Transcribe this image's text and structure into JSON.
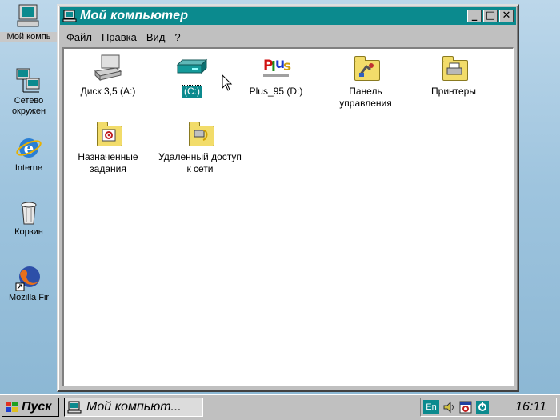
{
  "desktop": {
    "icons": [
      {
        "label": "Мой компь",
        "icon": "my-computer-icon"
      },
      {
        "label": "Сетевое окружение",
        "label_line1": "Сетево",
        "label_line2": "окружен",
        "icon": "network-icon"
      },
      {
        "label": "Interne",
        "icon": "internet-explorer-icon"
      },
      {
        "label": "Корзин",
        "icon": "recycle-bin-icon"
      },
      {
        "label": "Mozilla Fir",
        "icon": "firefox-icon"
      }
    ]
  },
  "window": {
    "title": "Мой компьютер",
    "buttons": {
      "minimize": "_",
      "maximize": "□",
      "close": "✕"
    },
    "menu": [
      "Файл",
      "Правка",
      "Вид",
      "?"
    ],
    "items": [
      {
        "label": "Диск 3,5 (A:)",
        "icon": "floppy-drive-icon"
      },
      {
        "label": "(C:)",
        "icon": "hard-drive-icon",
        "selected": true
      },
      {
        "label": "Plus_95 (D:)",
        "icon": "cdrom-plus-icon"
      },
      {
        "label_line1": "Панель",
        "label_line2": "управления",
        "icon": "control-panel-icon"
      },
      {
        "label": "Принтеры",
        "icon": "printers-icon"
      },
      {
        "label_line1": "Назначенные",
        "label_line2": "задания",
        "icon": "scheduled-tasks-icon"
      },
      {
        "label_line1": "Удаленный доступ",
        "label_line2": "к сети",
        "icon": "dialup-network-icon"
      }
    ]
  },
  "taskbar": {
    "start_label": "Пуск",
    "task_label": "Мой компьют...",
    "language": "En",
    "clock": "16:11"
  },
  "colors": {
    "title_bar": "#0b8a8e",
    "window_face": "#c0c0c0",
    "desktop": "#9ec4de"
  }
}
